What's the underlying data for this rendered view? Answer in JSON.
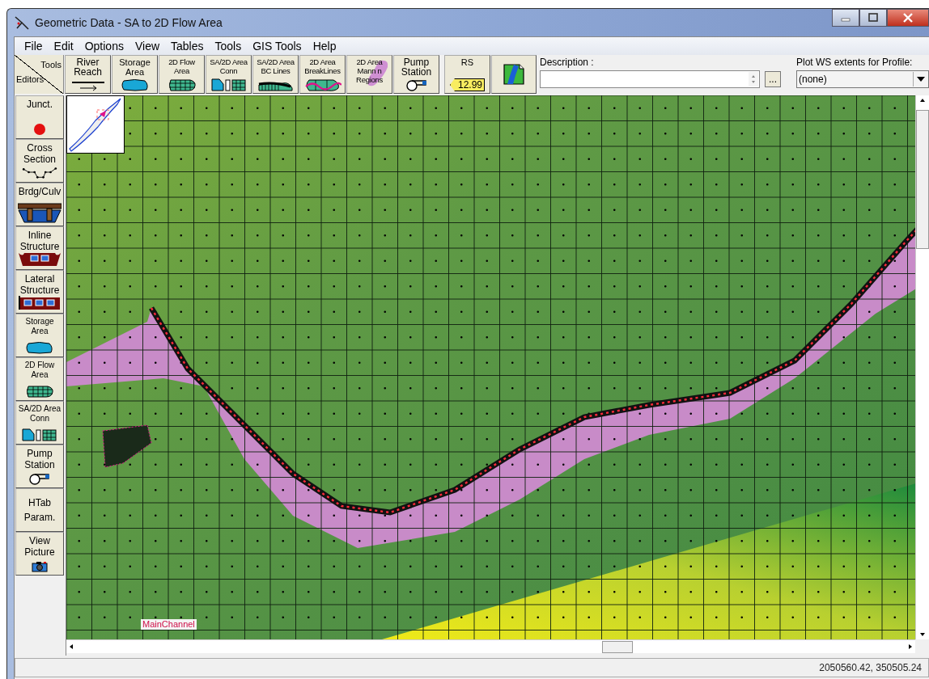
{
  "window": {
    "title": "Geometric Data - SA to 2D Flow Area"
  },
  "menu": [
    {
      "label": "File"
    },
    {
      "label": "Edit"
    },
    {
      "label": "Options"
    },
    {
      "label": "View"
    },
    {
      "label": "Tables"
    },
    {
      "label": "Tools"
    },
    {
      "label": "GIS Tools"
    },
    {
      "label": "Help"
    }
  ],
  "toolbar": {
    "corner": {
      "top": "Tools",
      "bottom": "Editors"
    },
    "tools": [
      {
        "kind": "reach",
        "label": "River\nReach"
      },
      {
        "kind": "storage",
        "label": "Storage\nArea"
      },
      {
        "kind": "flow2d",
        "label": "2D Flow\nArea"
      },
      {
        "kind": "conn",
        "label": "SA/2D Area\nConn"
      },
      {
        "kind": "bclines",
        "label": "SA/2D Area\nBC Lines"
      },
      {
        "kind": "breaklines",
        "label": "2D Area\nBreakLines"
      },
      {
        "kind": "mann",
        "label": "2D Area\nMann n\nRegions"
      },
      {
        "kind": "pump",
        "label": "Pump\nStation"
      }
    ],
    "rs": {
      "label": "RS",
      "tag": "12.99"
    },
    "description": {
      "label": "Description :"
    },
    "more_button": "...",
    "profile": {
      "label": "Plot WS extents for Profile:",
      "value": "(none)"
    }
  },
  "editors": [
    {
      "kind": "junct",
      "label": "Junct."
    },
    {
      "kind": "xs",
      "label": "Cross\nSection"
    },
    {
      "kind": "bridge",
      "label": "Brdg/Culv"
    },
    {
      "kind": "inline",
      "label": "Inline\nStructure"
    },
    {
      "kind": "lateral",
      "label": "Lateral\nStructure"
    },
    {
      "kind": "storage",
      "label": "Storage\nArea"
    },
    {
      "kind": "flow2d",
      "label": "2D Flow\nArea"
    },
    {
      "kind": "conn",
      "label": "SA/2D Area\nConn"
    },
    {
      "kind": "pump",
      "label": "Pump\nStation"
    },
    {
      "kind": "none",
      "label": "HTab\nParam."
    },
    {
      "kind": "camera",
      "label": "View\nPicture"
    }
  ],
  "map": {
    "reach_label": "MainChannel"
  },
  "status_bar": {
    "coordinates": "2050560.42, 350505.24"
  }
}
